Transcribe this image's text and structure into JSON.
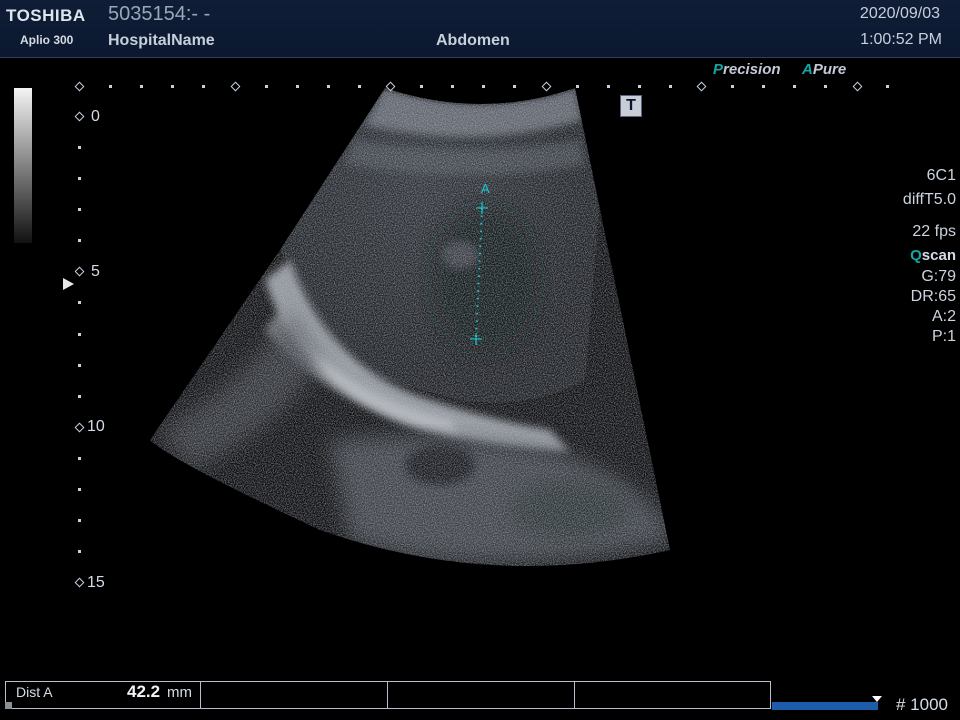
{
  "header": {
    "brand": "TOSHIBA",
    "model": "Aplio 300",
    "patient_id": "5035154:- -",
    "hospital": "HospitalName",
    "exam": "Abdomen",
    "date": "2020/09/03",
    "time": "1:00:52 PM"
  },
  "modes": {
    "precision_accent": "P",
    "precision_rest": "recision",
    "apure_accent": "A",
    "apure_rest": "Pure"
  },
  "marker_t": "T",
  "depth_labels": [
    "0",
    "5",
    "10",
    "15"
  ],
  "params": {
    "probe": "6C1",
    "preset": "diffT5.0",
    "fps": "22 fps",
    "qscan_accent": "Q",
    "qscan_rest": "scan",
    "gain": "G:79",
    "dynamic_range": "DR:65",
    "a_value": "A:2",
    "p_value": "P:1"
  },
  "measurement": {
    "caliper_label": "A",
    "dist_label": "Dist A",
    "dist_value": "42.2",
    "dist_unit": "mm"
  },
  "footer": {
    "frame": "# 1000"
  },
  "colors": {
    "accent_teal": "#14a5a5",
    "caliper_cyan": "#18c6d4",
    "header_bg": "#0b1830",
    "progress_blue": "#1c5cab"
  }
}
